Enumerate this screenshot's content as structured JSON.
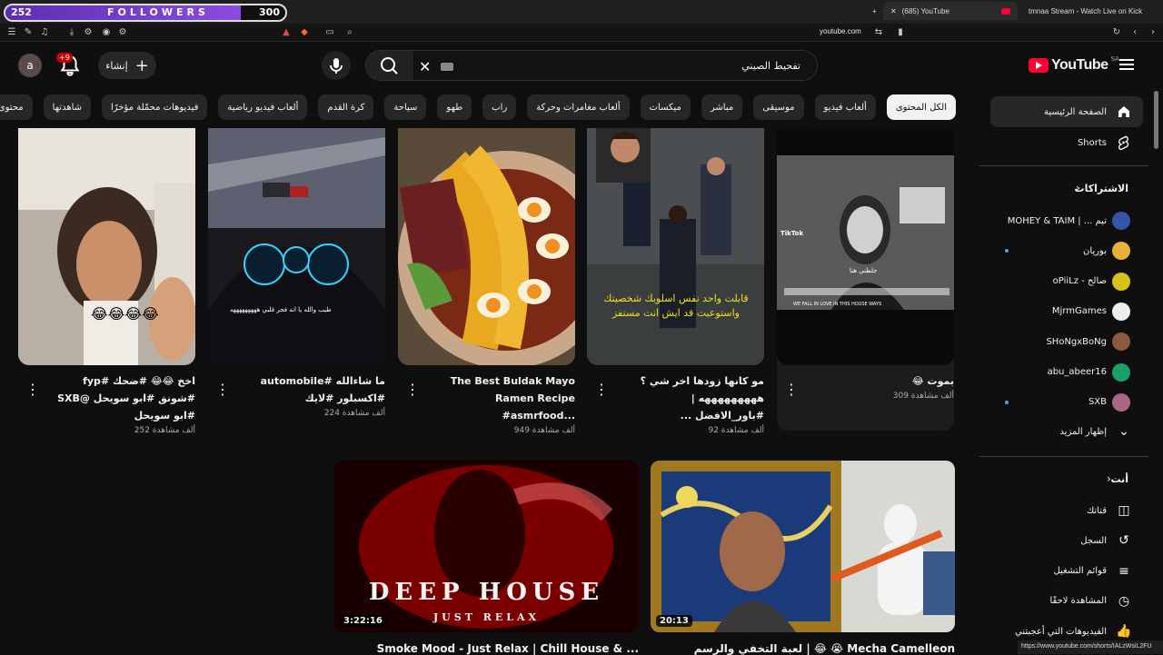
{
  "overlay": {
    "followers_label": "FOLLOWERS",
    "current": "252",
    "goal": "300",
    "progress": 0.84
  },
  "browser": {
    "tabs": [
      {
        "title": "(685) YouTube"
      },
      {
        "title": "tmnaa Stream - Watch Live on Kick"
      }
    ],
    "url": "youtube.com"
  },
  "masthead": {
    "avatar_letter": "a",
    "notifications_badge": "+9",
    "create_label": "إنشاء",
    "search_value": "تفحيط الصيني",
    "logo_text": "YouTube",
    "country_code": "SA"
  },
  "chips": [
    "الكل المحتوى",
    "ألعاب فيديو",
    "موسيقى",
    "مباشر",
    "ميكسات",
    "ألعاب مغامرات وحركة",
    "راب",
    "طهو",
    "سياحة",
    "كرة القدم",
    "ألعاب فيديو رياضية",
    "فيديوهات محمّلة مؤخرًا",
    "شاهدتها",
    "محتوى جديد لك"
  ],
  "sidebar": {
    "home": "الصفحة الرئيسية",
    "shorts": "Shorts",
    "subs_header": "الاشتراكات",
    "subscriptions": [
      {
        "name": "MOHEY & TAIM | ... تيم",
        "color": "#3355aa",
        "dot": false
      },
      {
        "name": "بوريان",
        "color": "#e8b23a",
        "dot": true
      },
      {
        "name": "oPiiLz - صالح",
        "color": "#d6c21a",
        "dot": false
      },
      {
        "name": "MjrmGames",
        "color": "#eeeeee",
        "dot": false
      },
      {
        "name": "SHoNgxBoNg",
        "color": "#8a5a3a",
        "dot": false
      },
      {
        "name": "abu_abeer16",
        "color": "#1aa06a",
        "dot": false
      },
      {
        "name": "SXB",
        "color": "#aa6688",
        "dot": true
      }
    ],
    "show_more": "إظهار المزيد",
    "you_header": "أنت",
    "you_items": [
      {
        "label": "قناتك",
        "icon": "channel-icon"
      },
      {
        "label": "السجل",
        "icon": "history-icon"
      },
      {
        "label": "قوائم التشغيل",
        "icon": "playlists-icon"
      },
      {
        "label": "المشاهدة لاحقًا",
        "icon": "watch-later-icon"
      },
      {
        "label": "الفيديوهات التي أعجبتني",
        "icon": "like-icon"
      }
    ]
  },
  "shorts": [
    {
      "title": "اخخ 😂😂 #ضحك #fyp #شونق #ابو سويحل @SXB #ابو سويحل",
      "views": "252 ألف مشاهدة"
    },
    {
      "title": "ما شاءالله #automobile #اكسبلور #لايك",
      "views": "224 ألف مشاهدة"
    },
    {
      "title": "The Best Buldak Mayo Ramen Recipe #asmrfood...",
      "views": "949 ألف مشاهدة"
    },
    {
      "title": "مو كانها زودها اخر شي ؟ هههههههههه | #باور_الافضل ...",
      "views": "92 ألف مشاهدة"
    },
    {
      "title": "بموت 😂",
      "views": "309 ألف مشاهدة"
    }
  ],
  "short_overlays": {
    "s2_caption": "طيب والله يا انه فجر قلبي هههههههههه",
    "s4_caption": "قابلت واحد نفس اسلوبك شخصيتك واستوعبت قد ايش انت مستفز",
    "s5_caption": "جلطني هنا",
    "s5_tiktok": "TikTok",
    "s5_caption2": "WE FALL IN LOVE IN THIS HOUSE WAYS"
  },
  "videos": [
    {
      "title": "Smoke Mood - Just Relax | Chill House & ...",
      "duration": "3:22:16",
      "thumb_title": "DEEP HOUSE",
      "thumb_sub": "JUST RELAX"
    },
    {
      "title": "لعبة التخفي والرسم | 😂 😭 Mecha Camelleon",
      "duration": "20:13"
    }
  ],
  "status_url": "https://www.youtube.com/shorts/IALzWsiL2FU",
  "colors": {
    "accent": "#ff0033",
    "chip_bg": "#272727",
    "bg": "#0f0f0f"
  }
}
